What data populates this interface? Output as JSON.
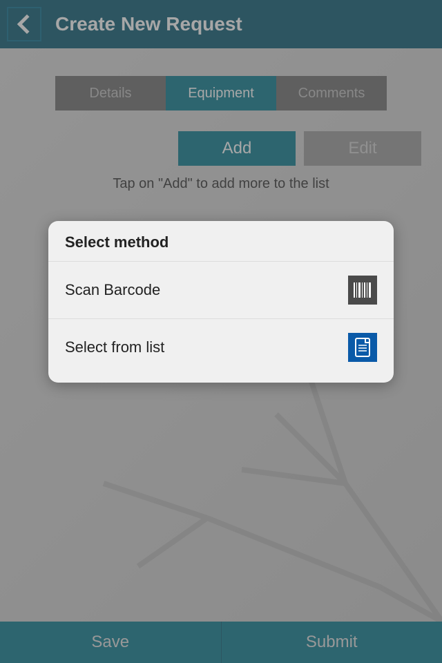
{
  "header": {
    "title": "Create New Request"
  },
  "tabs": {
    "details": "Details",
    "equipment": "Equipment",
    "comments": "Comments"
  },
  "buttons": {
    "add": "Add",
    "edit": "Edit"
  },
  "hint": "Tap on \"Add\" to add more to the list",
  "modal": {
    "title": "Select method",
    "options": {
      "scan": "Scan Barcode",
      "list": "Select from list"
    }
  },
  "footer": {
    "save": "Save",
    "submit": "Submit"
  }
}
